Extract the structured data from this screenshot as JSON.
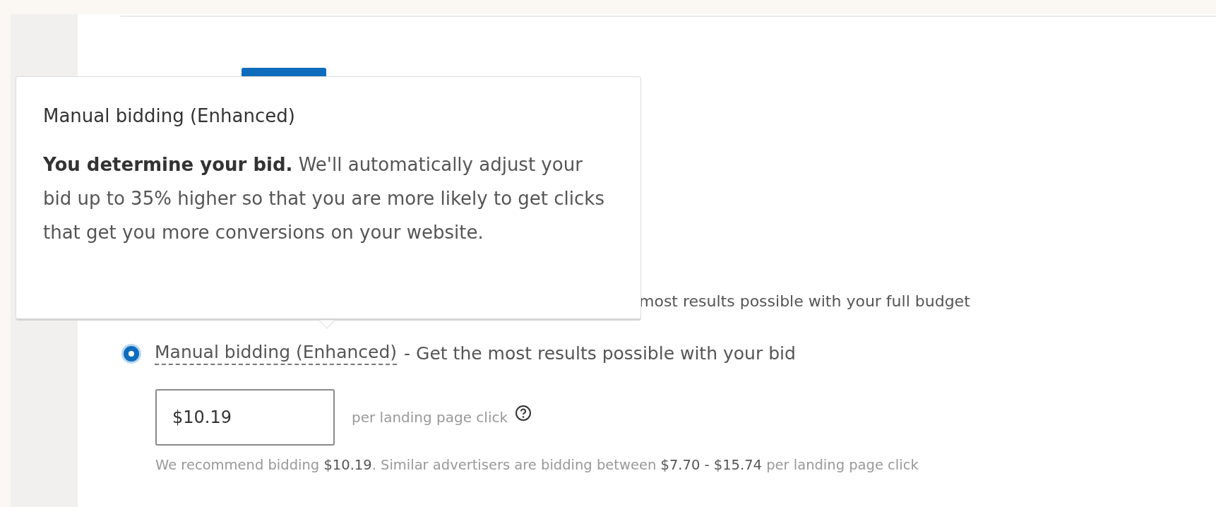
{
  "section_tab": {
    "selected": true
  },
  "tooltip": {
    "title": "Manual bidding (Enhanced)",
    "body": "**You determine your bid.** We'll automatically adjust your bid up to 35% higher so that you are more likely to get clicks that get you more conversions on your website."
  },
  "partially_hidden_option": {
    "text": "most results possible with your full budget"
  },
  "option": {
    "label": "Manual bidding (Enhanced)",
    "description": "- Get the most results possible with your bid",
    "selected": true
  },
  "bid": {
    "value": "$10.19",
    "unit": "per landing page click"
  },
  "recommendation": "We recommend bidding **$10.19**. Similar advertisers are bidding between **$7.70 - $15.74** per landing page click"
}
